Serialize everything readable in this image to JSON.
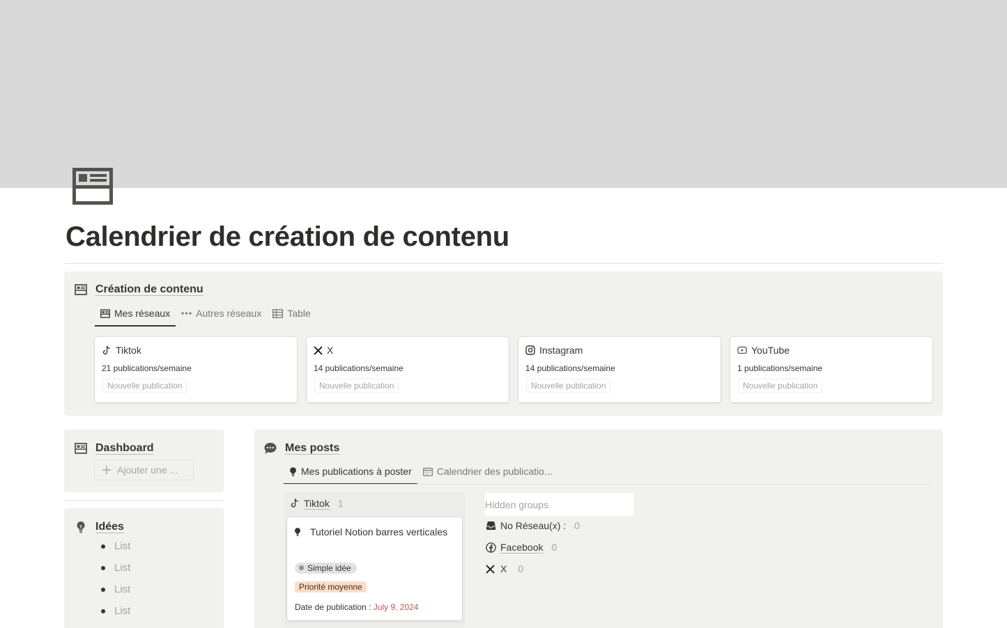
{
  "page": {
    "title": "Calendrier de création de contenu"
  },
  "creation": {
    "title": "Création de contenu",
    "tabs": [
      {
        "label": "Mes réseaux",
        "icon": "gallery-icon",
        "active": true
      },
      {
        "label": "Autres réseaux",
        "icon": "more-horizontal-icon",
        "active": false
      },
      {
        "label": "Table",
        "icon": "table-icon",
        "active": false
      }
    ],
    "cards": [
      {
        "title": "Tiktok",
        "icon": "tiktok-icon",
        "subtitle": "21 publications/semaine",
        "button": "Nouvelle publication"
      },
      {
        "title": "X",
        "icon": "x-logo-icon",
        "subtitle": "14 publications/semaine",
        "button": "Nouvelle publication"
      },
      {
        "title": "Instagram",
        "icon": "instagram-icon",
        "subtitle": "14 publications/semaine",
        "button": "Nouvelle publication"
      },
      {
        "title": "YouTube",
        "icon": "youtube-icon",
        "subtitle": "1 publications/semaine",
        "button": "Nouvelle publication"
      }
    ]
  },
  "dashboard": {
    "title": "Dashboard",
    "add_button": "Ajouter une ..."
  },
  "idees": {
    "title": "Idées",
    "items": [
      "List",
      "List",
      "List",
      "List"
    ]
  },
  "posts": {
    "title": "Mes posts",
    "tabs": [
      {
        "label": "Mes publications à poster",
        "icon": "lightbulb-icon",
        "active": true
      },
      {
        "label": "Calendrier des publicatio...",
        "icon": "calendar-icon",
        "active": false
      }
    ],
    "group": {
      "name": "Tiktok",
      "count": "1",
      "card": {
        "title": "Tutoriel Notion barres verticales",
        "status": "Simple idée",
        "priority": "Priorité moyenne",
        "date_label": "Date de publication : ",
        "date_value": "July 9, 2024"
      }
    },
    "hidden_groups": {
      "label": "Hidden groups",
      "items": [
        {
          "name": "No Réseau(x) :",
          "icon": "inbox-icon",
          "count": "0"
        },
        {
          "name": "Facebook",
          "icon": "facebook-icon",
          "count": "0"
        },
        {
          "name": "X",
          "icon": "x-logo-icon",
          "count": "0"
        }
      ]
    }
  },
  "colors": {
    "cover": "#d9d9d9",
    "block_bg": "#f1f1ef",
    "priority_bg": "#fadec9",
    "status_bg": "#e3e2e0",
    "date_red": "#c4554d"
  }
}
